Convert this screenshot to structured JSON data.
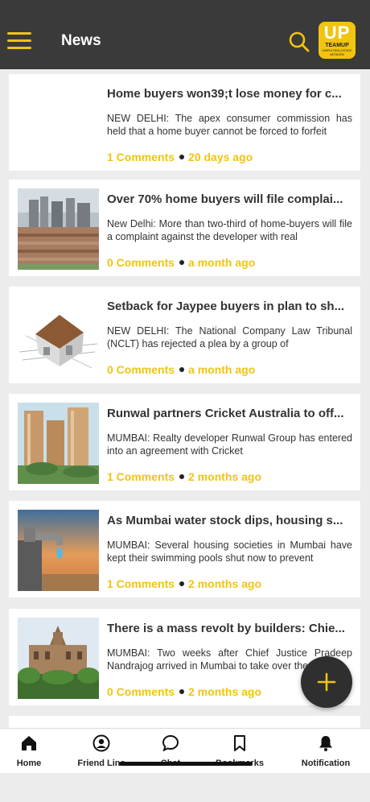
{
  "header": {
    "title": "News",
    "logo_mark": "UP",
    "logo_text": "TEAMUP",
    "logo_sub": "SIMPLE REAL ESTATE NETWORK"
  },
  "feed": {
    "items": [
      {
        "title": "Home buyers won39;t lose money for c...",
        "excerpt": "NEW DELHI: The apex consumer commission has held that a home buyer cannot be forced to forfeit",
        "comments": "1 Comments",
        "time": "20 days ago",
        "image": "none"
      },
      {
        "title": "Over 70% home buyers will file complai...",
        "excerpt": "New Delhi: More than two-third of home-buyers will file a complaint against the developer with real",
        "comments": "0 Comments",
        "time": "a month ago",
        "image": "city-skyline"
      },
      {
        "title": "Setback for Jaypee buyers in plan to sh...",
        "excerpt": "NEW DELHI: The National Company Law Tribunal (NCLT) has rejected a plea by a group of",
        "comments": "0 Comments",
        "time": "a month ago",
        "image": "house-blueprint"
      },
      {
        "title": "Runwal partners Cricket Australia to off...",
        "excerpt": "MUMBAI: Realty developer Runwal Group has entered into an agreement with Cricket",
        "comments": "1 Comments",
        "time": "2 months ago",
        "image": "towers"
      },
      {
        "title": "As Mumbai water stock dips, housing s...",
        "excerpt": "MUMBAI: Several housing societies in Mumbai have kept their swimming pools shut now to prevent",
        "comments": "1 Comments",
        "time": "2 months ago",
        "image": "water-tap"
      },
      {
        "title": "There is a mass revolt by builders: Chie...",
        "excerpt": "MUMBAI: Two weeks after Chief Justice Pradeep Nandrajog arrived in Mumbai to take over the",
        "comments": "0 Comments",
        "time": "2 months ago",
        "image": "court-building"
      }
    ]
  },
  "bottom_nav": {
    "items": [
      {
        "label": "Home",
        "icon": "home-icon",
        "active": true
      },
      {
        "label": "Friend Line",
        "icon": "friend-line-icon",
        "active": false
      },
      {
        "label": "Chat",
        "icon": "chat-icon",
        "active": false
      },
      {
        "label": "Bookmarks",
        "icon": "bookmark-icon",
        "active": false
      },
      {
        "label": "Notification",
        "icon": "bell-icon",
        "active": false
      }
    ]
  },
  "colors": {
    "accent": "#f2c40f",
    "header_bg": "#3a3a3a",
    "card_bg": "#ffffff",
    "page_bg": "#ececec"
  }
}
